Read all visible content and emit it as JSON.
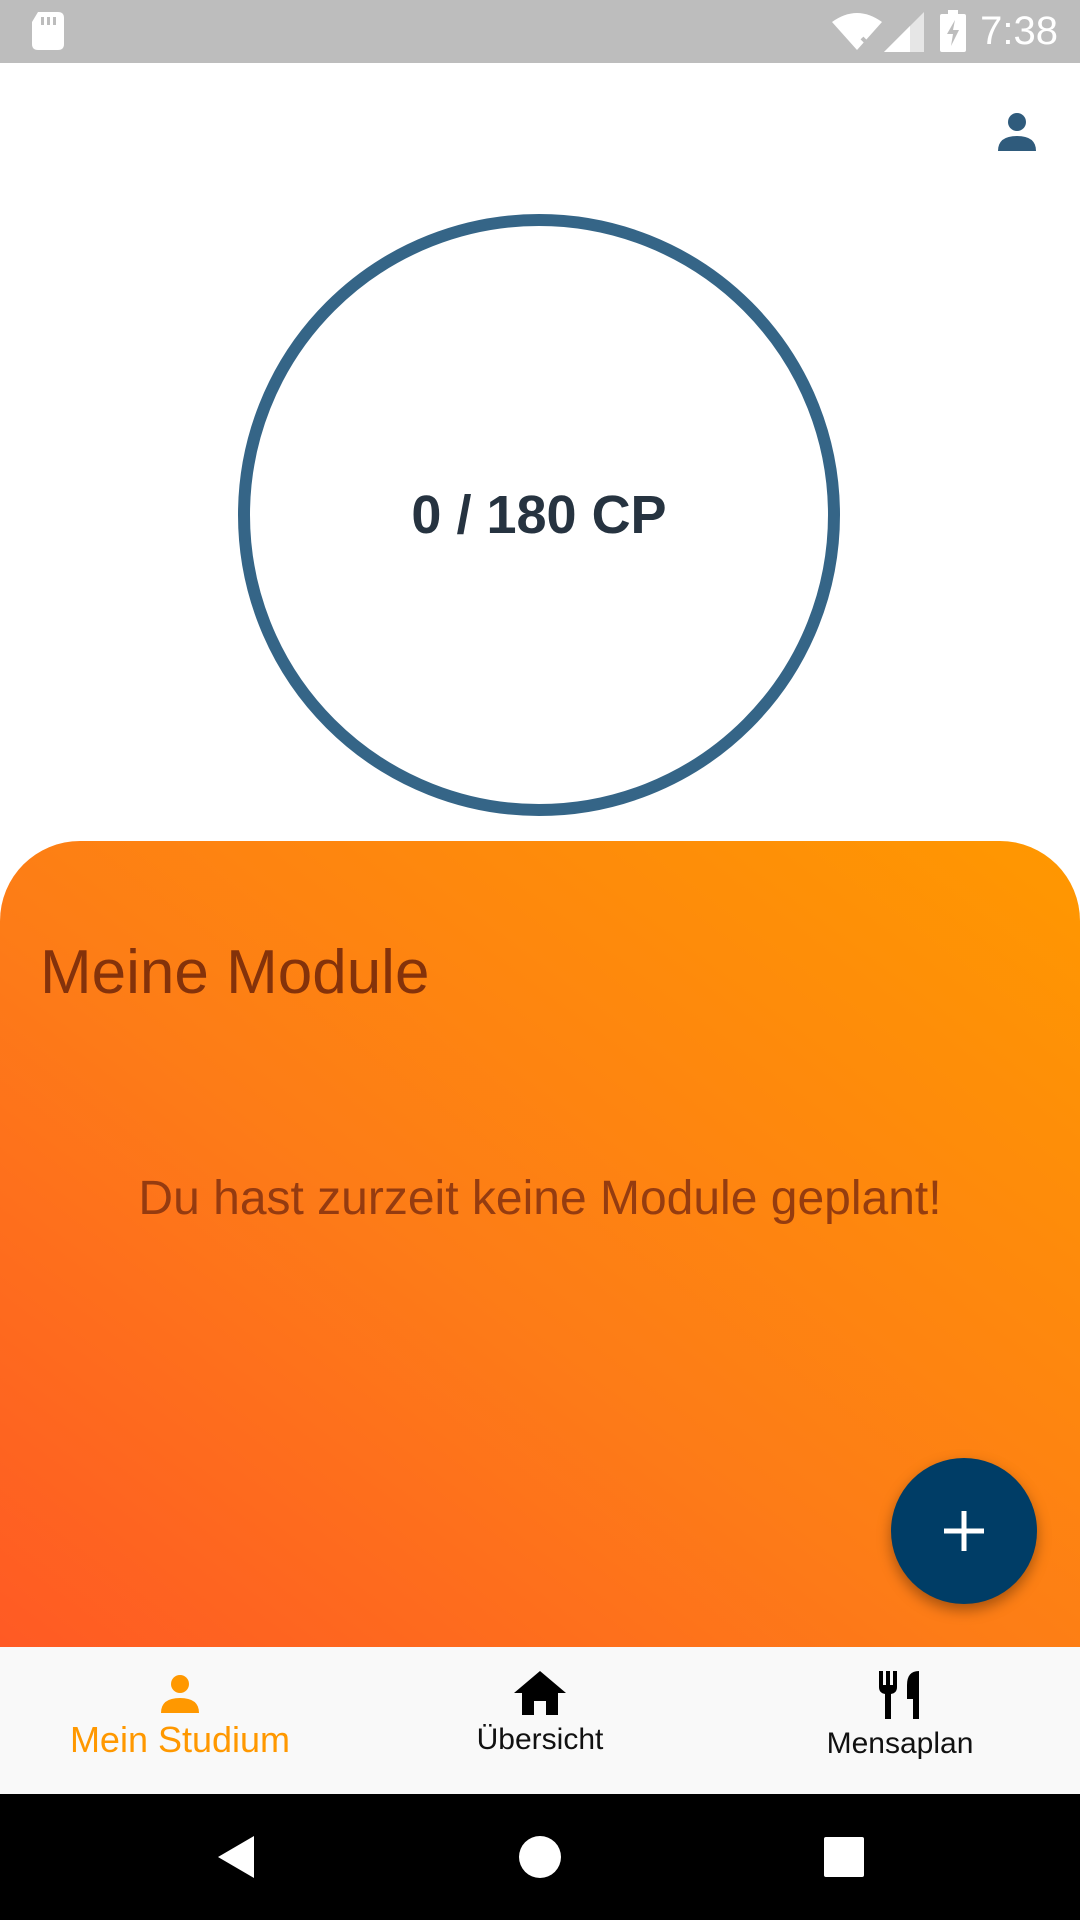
{
  "status_bar": {
    "time": "7:38",
    "icons": [
      "sd-card-icon",
      "wifi-off-icon",
      "cell-signal-icon",
      "battery-charging-icon"
    ]
  },
  "header": {
    "profile_icon": "person-icon"
  },
  "progress": {
    "label": "0 / 180 CP",
    "current": 0,
    "total": 180,
    "ring_color": "#356587"
  },
  "modules": {
    "title": "Meine Module",
    "empty_message": "Du hast zurzeit keine Module geplant!",
    "gradient_colors": [
      "#ff5a24",
      "#ff9800"
    ],
    "add_icon": "plus-icon",
    "fab_color": "#003d66"
  },
  "bottom_nav": {
    "active_color": "#ff9800",
    "items": [
      {
        "label": "Mein Studium",
        "icon": "person-icon",
        "active": true
      },
      {
        "label": "Übersicht",
        "icon": "home-icon",
        "active": false
      },
      {
        "label": "Mensaplan",
        "icon": "restaurant-icon",
        "active": false
      }
    ]
  },
  "system_nav": {
    "buttons": [
      "back-icon",
      "home-circle-icon",
      "recents-icon"
    ]
  }
}
